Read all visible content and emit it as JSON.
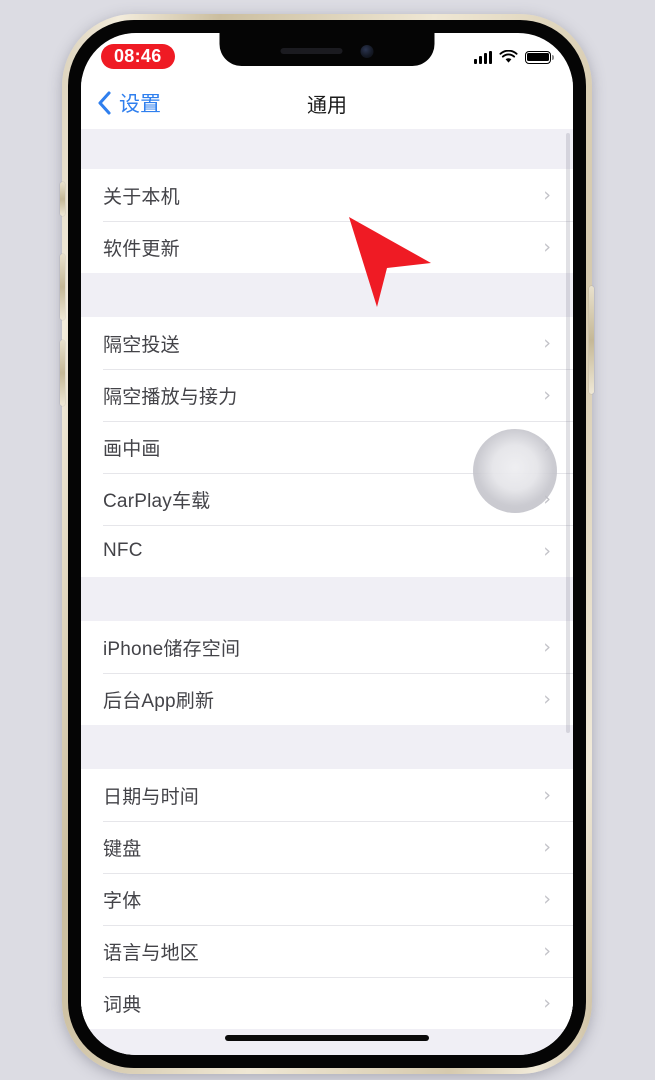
{
  "device": {
    "frame_color": "#d9cfb8",
    "bezel_color": "#050505",
    "buttons": {
      "mute_switch": "mute-switch",
      "volume_up": "volume-up",
      "volume_down": "volume-down",
      "power": "power-button"
    }
  },
  "status_bar": {
    "time": "08:46",
    "time_pill_color": "#ef1b24",
    "signal_icon": "cellular-signal-icon",
    "wifi_icon": "wifi-icon",
    "battery_icon": "battery-icon"
  },
  "nav_bar": {
    "back_icon": "chevron-left-icon",
    "back_label": "设置",
    "title": "通用",
    "accent_color": "#2f7fee"
  },
  "overlays": {
    "cursor_icon": "red-arrow-cursor-icon",
    "cursor_color": "#ef1b24",
    "touch_indicator": "touch-tap-indicator"
  },
  "settings": {
    "groups": [
      {
        "rows": [
          {
            "label": "关于本机",
            "chevron": "›"
          },
          {
            "label": "软件更新",
            "chevron": "›"
          }
        ]
      },
      {
        "rows": [
          {
            "label": "隔空投送",
            "chevron": "›"
          },
          {
            "label": "隔空播放与接力",
            "chevron": "›"
          },
          {
            "label": "画中画",
            "chevron": "›"
          },
          {
            "label": "CarPlay车载",
            "chevron": "›"
          },
          {
            "label": "NFC",
            "chevron": "›"
          }
        ]
      },
      {
        "rows": [
          {
            "label": "iPhone储存空间",
            "chevron": "›"
          },
          {
            "label": "后台App刷新",
            "chevron": "›"
          }
        ]
      },
      {
        "rows": [
          {
            "label": "日期与时间",
            "chevron": "›"
          },
          {
            "label": "键盘",
            "chevron": "›"
          },
          {
            "label": "字体",
            "chevron": "›"
          },
          {
            "label": "语言与地区",
            "chevron": "›"
          },
          {
            "label": "词典",
            "chevron": "›"
          }
        ]
      }
    ]
  }
}
